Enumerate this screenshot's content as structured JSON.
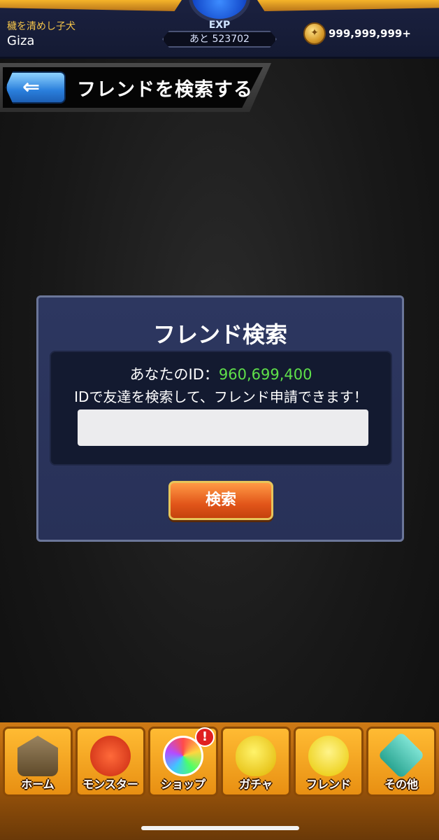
{
  "status_bar": {
    "player_title": "穢を清めし子犬",
    "player_name": "Giza",
    "exp_label": "EXP",
    "exp_remaining": "あと 523702",
    "coin_value": "999,999,999+"
  },
  "header": {
    "title": "フレンドを検索する"
  },
  "dialog": {
    "title": "フレンド検索",
    "id_prefix": "あなたのID：",
    "id_value": "960,699,400",
    "description": "IDで友達を検索して、フレンド申請できます！",
    "input_value": "",
    "input_placeholder": "",
    "search_button": "検索"
  },
  "bottom_nav": {
    "items": [
      {
        "label": "ホーム",
        "icon": "home-icon"
      },
      {
        "label": "モンスター",
        "icon": "monster-icon"
      },
      {
        "label": "ショップ",
        "icon": "shop-icon",
        "badge": "!"
      },
      {
        "label": "ガチャ",
        "icon": "gacha-icon"
      },
      {
        "label": "フレンド",
        "icon": "friend-icon"
      },
      {
        "label": "その他",
        "icon": "other-icon"
      }
    ]
  },
  "colors": {
    "accent_gold": "#f5b42a",
    "id_green": "#5fe04a",
    "button_orange": "#e2561a",
    "dialog_bg": "#2d3760"
  }
}
